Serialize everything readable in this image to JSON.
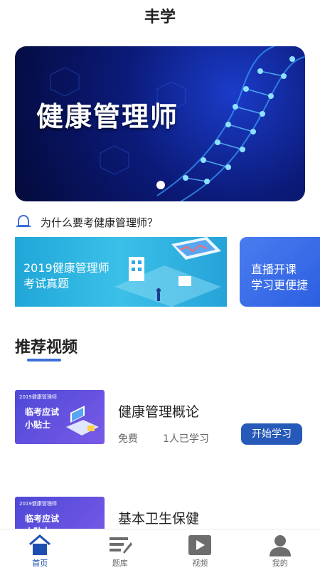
{
  "app": {
    "title": "丰学"
  },
  "hero": {
    "text": "健康管理师"
  },
  "notice": {
    "text": "为什么要考健康管理师？"
  },
  "banners": [
    {
      "line1": "2019健康管理师",
      "line2": "考试真题"
    },
    {
      "line1": "直播开课",
      "line2": "学习更便捷"
    }
  ],
  "section": {
    "title": "推荐视频"
  },
  "videos": [
    {
      "thumb_small": "2019健康管理师",
      "thumb_line1": "临考应试",
      "thumb_line2": "小贴士",
      "title": "健康管理概论",
      "price": "免费",
      "learners": "1人已学习",
      "button": "开始学习"
    },
    {
      "thumb_small": "2019健康管理师",
      "thumb_line1": "临考应试",
      "thumb_line2": "小贴士",
      "title": "基本卫生保健"
    }
  ],
  "tabbar": {
    "items": [
      {
        "label": "首页",
        "icon": "home-icon",
        "active": true
      },
      {
        "label": "题库",
        "icon": "question-bank-icon",
        "active": false
      },
      {
        "label": "视频",
        "icon": "video-icon",
        "active": false
      },
      {
        "label": "我的",
        "icon": "profile-icon",
        "active": false
      }
    ]
  },
  "colors": {
    "accent": "#2659b8",
    "active_tab": "#1e4fb0"
  }
}
